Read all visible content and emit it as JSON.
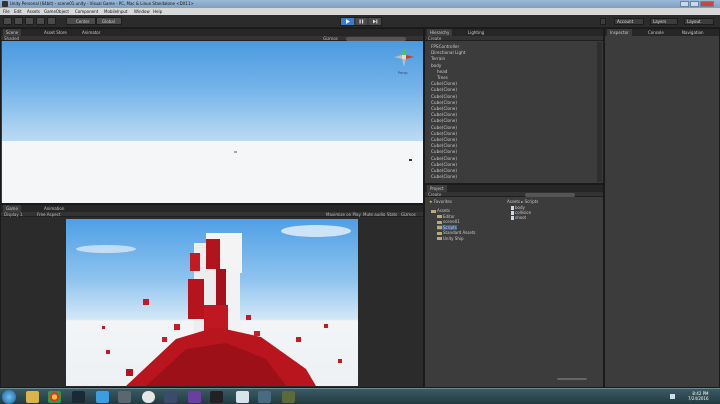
{
  "window": {
    "title": "Unity Personal (64bit) - scene01.unity - Visual Game - PC, Mac & Linux Standalone <DX11>"
  },
  "menu": [
    "File",
    "Edit",
    "Assets",
    "GameObject",
    "Component",
    "MobileInput",
    "Window",
    "Help"
  ],
  "toolbar": {
    "pivot_label": "Center",
    "space_label": "Global",
    "account": "Account",
    "layers": "Layers",
    "layout": "Layout"
  },
  "scene_panel": {
    "tabs": [
      "Scene",
      "Asset Store",
      "Animator"
    ],
    "shading": "Shaded",
    "gizmos": "Gizmos",
    "search_placeholder": "All",
    "persp_label": "Persp"
  },
  "game_panel": {
    "tabs": [
      "Game",
      "Animation"
    ],
    "display": "Display 1",
    "aspect": "Free Aspect",
    "options": [
      "Maximize on Play",
      "Mute audio",
      "Stats",
      "Gizmos"
    ]
  },
  "hierarchy": {
    "tabs": [
      "Hierarchy",
      "Lighting"
    ],
    "create": "Create",
    "items": [
      {
        "label": "FPSController",
        "indent": 0
      },
      {
        "label": "Directional Light",
        "indent": 0
      },
      {
        "label": "Terrain",
        "indent": 0
      },
      {
        "label": "body",
        "indent": 0
      },
      {
        "label": "head",
        "indent": 1
      },
      {
        "label": "Trees",
        "indent": 1
      },
      {
        "label": "Cube(Clone)",
        "indent": 0
      },
      {
        "label": "Cube(Clone)",
        "indent": 0
      },
      {
        "label": "Cube(Clone)",
        "indent": 0
      },
      {
        "label": "Cube(Clone)",
        "indent": 0
      },
      {
        "label": "Cube(Clone)",
        "indent": 0
      },
      {
        "label": "Cube(Clone)",
        "indent": 0
      },
      {
        "label": "Cube(Clone)",
        "indent": 0
      },
      {
        "label": "Cube(Clone)",
        "indent": 0
      },
      {
        "label": "Cube(Clone)",
        "indent": 0
      },
      {
        "label": "Cube(Clone)",
        "indent": 0
      },
      {
        "label": "Cube(Clone)",
        "indent": 0
      },
      {
        "label": "Cube(Clone)",
        "indent": 0
      },
      {
        "label": "Cube(Clone)",
        "indent": 0
      },
      {
        "label": "Cube(Clone)",
        "indent": 0
      },
      {
        "label": "Cube(Clone)",
        "indent": 0
      },
      {
        "label": "Cube(Clone)",
        "indent": 0
      }
    ]
  },
  "project": {
    "tabs": [
      "Project"
    ],
    "create": "Create",
    "favorites": "Favorites",
    "breadcrumb": [
      "Assets",
      "Scripts"
    ],
    "tree": [
      {
        "label": "Assets",
        "indent": 0
      },
      {
        "label": "Editor",
        "indent": 1
      },
      {
        "label": "scene01",
        "indent": 1
      },
      {
        "label": "Scripts",
        "indent": 1
      },
      {
        "label": "Standard Assets",
        "indent": 1
      },
      {
        "label": "Unity Ship",
        "indent": 1
      }
    ],
    "files": [
      "body",
      "collision",
      "shoot"
    ]
  },
  "inspector": {
    "tabs": [
      "Inspector",
      "Console",
      "Navigation"
    ]
  },
  "taskbar": {
    "time": "8:42 PM",
    "date": "7/24/2016"
  }
}
